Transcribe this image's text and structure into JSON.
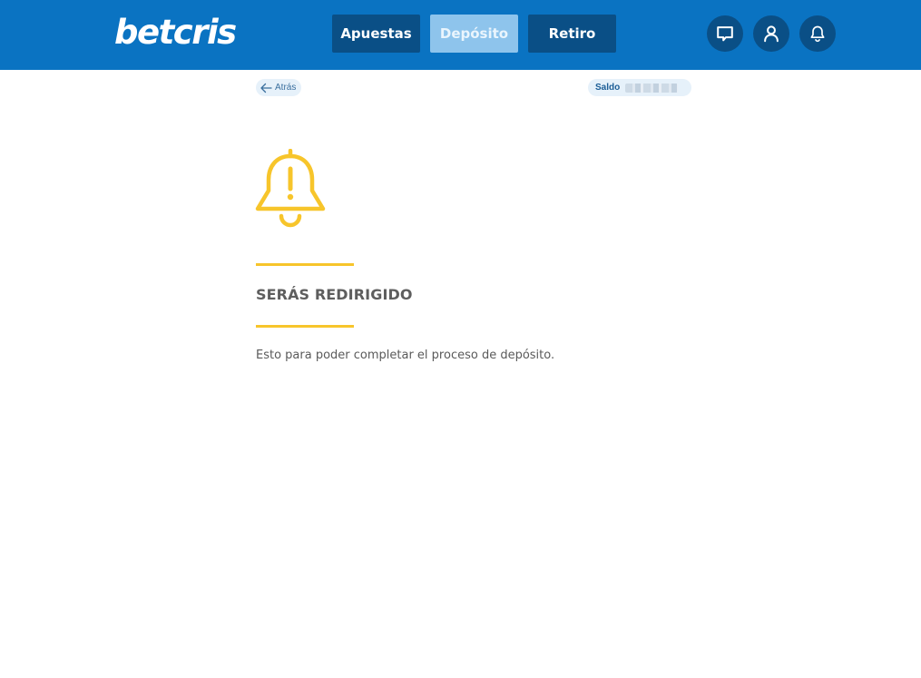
{
  "brand": {
    "logo_text": "betcris"
  },
  "nav": {
    "apuestas": "Apuestas",
    "deposito": "Depósito",
    "retiro": "Retiro"
  },
  "icons": {
    "chat": "chat-icon",
    "user": "user-icon",
    "bell": "bell-icon",
    "back": "arrow-left-icon",
    "alert": "bell-alert-icon"
  },
  "toolbar": {
    "back_label": "Atrás",
    "saldo_label": "Saldo"
  },
  "content": {
    "title": "SERÁS REDIRIGIDO",
    "message": "Esto para poder completar el proceso de depósito."
  },
  "colors": {
    "header_bg": "#0a73c2",
    "nav_button": "#0a4f86",
    "nav_active": "#8ec4ec",
    "accent_yellow": "#f7c52b"
  }
}
